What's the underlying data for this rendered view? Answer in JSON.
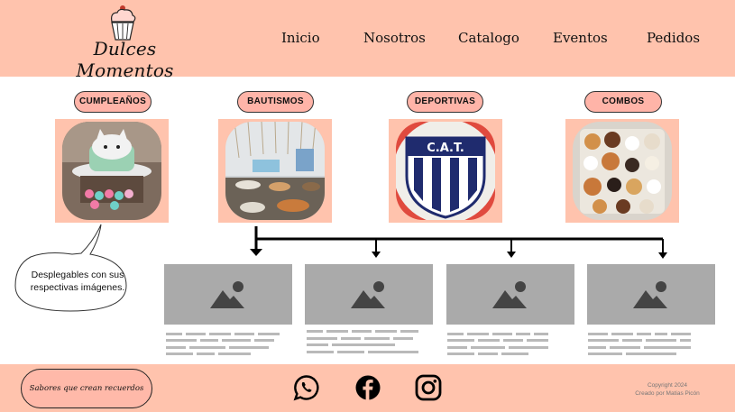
{
  "brand": {
    "name": "Dulces Momentos",
    "logo_icon": "cupcake-icon"
  },
  "nav": [
    {
      "label": "Inicio"
    },
    {
      "label": "Nosotros"
    },
    {
      "label": "Catalogo"
    },
    {
      "label": "Eventos"
    },
    {
      "label": "Pedidos"
    }
  ],
  "categories": [
    {
      "label": "CUMPLEAÑOS",
      "image": "birthday-cake-photo"
    },
    {
      "label": "BAUTISMOS",
      "image": "baptism-table-photo"
    },
    {
      "label": "DEPORTIVAS",
      "image": "sports-team-cake-photo"
    },
    {
      "label": "COMBOS",
      "image": "pastries-combo-photo"
    }
  ],
  "crest_text": "C.A.T.",
  "callout": {
    "text": "Desplegables con sus respectivas imágenes."
  },
  "cards": [
    {
      "image": "image-placeholder-icon"
    },
    {
      "image": "image-placeholder-icon"
    },
    {
      "image": "image-placeholder-icon"
    },
    {
      "image": "image-placeholder-icon"
    }
  ],
  "footer": {
    "slogan": "Sabores que crean recuerdos",
    "social": [
      "whatsapp-icon",
      "facebook-icon",
      "instagram-icon"
    ],
    "copyright_line1": "Copyright 2024",
    "copyright_line2": "Creado por Matias Picón"
  },
  "colors": {
    "header_bg": "#ffc3ad",
    "pill_bg": "#ffb4a8",
    "placeholder": "#aaaaaa",
    "placeholder_icon": "#444444"
  }
}
